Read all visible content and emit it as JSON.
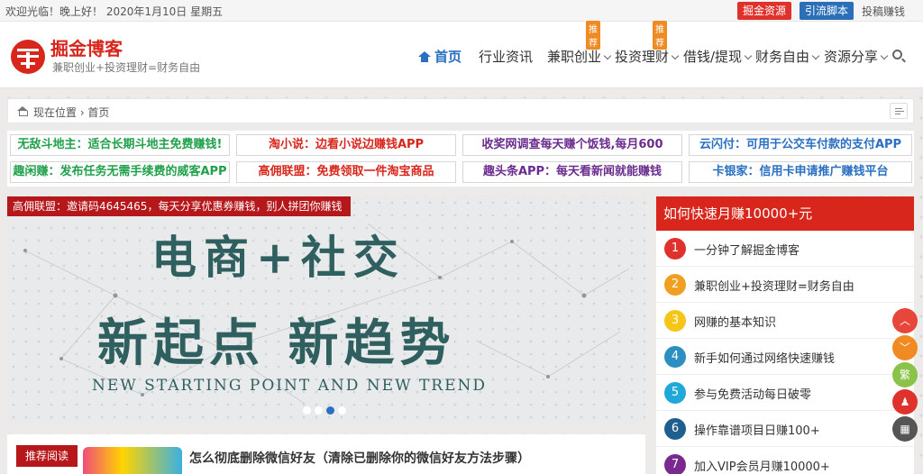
{
  "topbar": {
    "welcome": "欢迎光临！晚上好！ 2020年1月10日 星期五",
    "btn_red": "掘金资源",
    "btn_blue": "引流脚本",
    "plain": "投稿赚钱"
  },
  "header": {
    "site_name": "掘金博客",
    "slogan": "兼职创业+投资理财=财务自由"
  },
  "nav": {
    "items": [
      {
        "label": "首页"
      },
      {
        "label": "行业资讯"
      },
      {
        "label": "兼职创业",
        "badge": "推荐"
      },
      {
        "label": "投资理财",
        "badge": "推荐"
      },
      {
        "label": "借钱/提现"
      },
      {
        "label": "财务自由"
      },
      {
        "label": "资源分享"
      }
    ]
  },
  "breadcrumb": {
    "text": "现在位置 › 首页"
  },
  "ads": [
    {
      "text": "无敌斗地主：适合长期斗地主免费赚钱!",
      "color": "#20a04a"
    },
    {
      "text": "淘小说：边看小说边赚钱APP",
      "color": "#d9261c"
    },
    {
      "text": "收奖网调查每天赚个饭钱,每月600",
      "color": "#6a2c8e"
    },
    {
      "text": "云闪付：可用于公交车付款的支付APP",
      "color": "#2a6fc1"
    },
    {
      "text": "趣闲赚：发布任务无需手续费的威客APP",
      "color": "#20a04a"
    },
    {
      "text": "高佣联盟：免费领取一件淘宝商品",
      "color": "#d9261c"
    },
    {
      "text": "趣头条APP：每天看新闻就能赚钱",
      "color": "#6a2c8e"
    },
    {
      "text": "卡银家：信用卡申请推广赚钱平台",
      "color": "#2a6fc1"
    }
  ],
  "slider": {
    "label": "高佣联盟：邀请码4645465，每天分享优惠券赚钱，别人拼团你赚钱",
    "headline1": "电商+社交",
    "headline2": "新起点 新趋势",
    "english": "NEW STARTING POINT AND NEW TREND",
    "active_dot": 3
  },
  "recommend": {
    "label": "推荐阅读",
    "title": "怎么彻底删除微信好友（清除已删除你的微信好友方法步骤）"
  },
  "sidebar": {
    "title": "如何快速月赚10000+元",
    "items": [
      {
        "num": "1",
        "text": "一分钟了解掘金博客",
        "color": "#e0322c"
      },
      {
        "num": "2",
        "text": "兼职创业+投资理财=财务自由",
        "color": "#f0a020"
      },
      {
        "num": "3",
        "text": "网赚的基本知识",
        "color": "#f5c518"
      },
      {
        "num": "4",
        "text": "新手如何通过网络快速赚钱",
        "color": "#2b8fc2"
      },
      {
        "num": "5",
        "text": "参与免费活动每日破零",
        "color": "#1fa8d8"
      },
      {
        "num": "6",
        "text": "操作靠谱项目日赚100+",
        "color": "#1f5f8f"
      },
      {
        "num": "7",
        "text": "加入VIP会员月赚10000+",
        "color": "#7a2a8f"
      }
    ]
  },
  "floats": [
    {
      "icon": "arrow-up-icon",
      "glyph": "︿",
      "color": "#e8463a"
    },
    {
      "icon": "arrow-down-icon",
      "glyph": "﹀",
      "color": "#f08a23"
    },
    {
      "icon": "traditional-chinese-icon",
      "glyph": "繁",
      "color": "#8bc34a"
    },
    {
      "icon": "qq-icon",
      "glyph": "♟",
      "color": "#e0322c"
    },
    {
      "icon": "qrcode-icon",
      "glyph": "▦",
      "color": "#555555"
    }
  ]
}
